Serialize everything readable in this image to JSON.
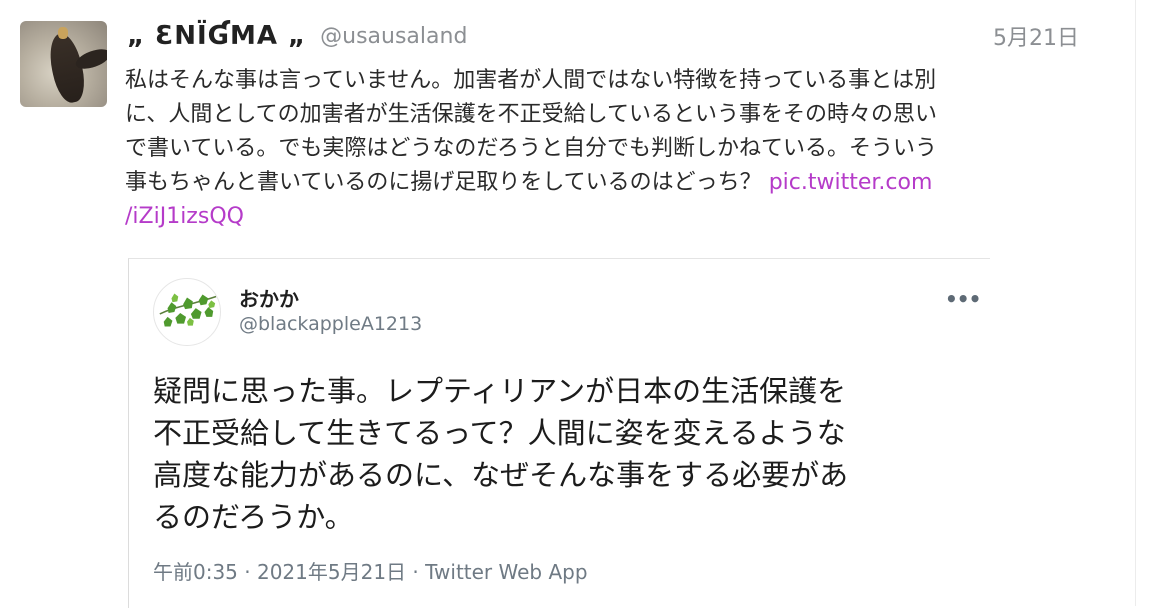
{
  "tweet": {
    "display_name": "„ ƐΝΪƓΜΑ „",
    "handle": "@usausaland",
    "date": "5月21日",
    "text_lines": [
      "私はそんな事は言っていません。加害者が人間ではない特徴を持っている事とは別",
      "に、人間としての加害者が生活保護を不正受給しているという事をその時々の思い",
      "で書いている。でも実際はどうなのだろうと自分でも判断しかねている。そういう",
      "事もちゃんと書いているのに揚げ足取りをしているのはどっち？ "
    ],
    "link_part1": "pic.twitter.com",
    "link_part2": "/iZiJ1izsQQ"
  },
  "quoted": {
    "display_name": "おかか",
    "handle": "@blackappleA1213",
    "more_icon": "more-dots-icon",
    "text_lines": [
      "疑問に思った事。レプティリアンが日本の生活保護を",
      "不正受給して生きてるって？人間に姿を変えるような",
      "高度な能力があるのに、なぜそんな事をする必要があ",
      "るのだろうか。"
    ],
    "meta": "午前0:35 · 2021年5月21日 · Twitter Web App"
  },
  "colors": {
    "link": "#b53bc9",
    "muted": "#8c8f93",
    "text": "#2a2a2a"
  }
}
